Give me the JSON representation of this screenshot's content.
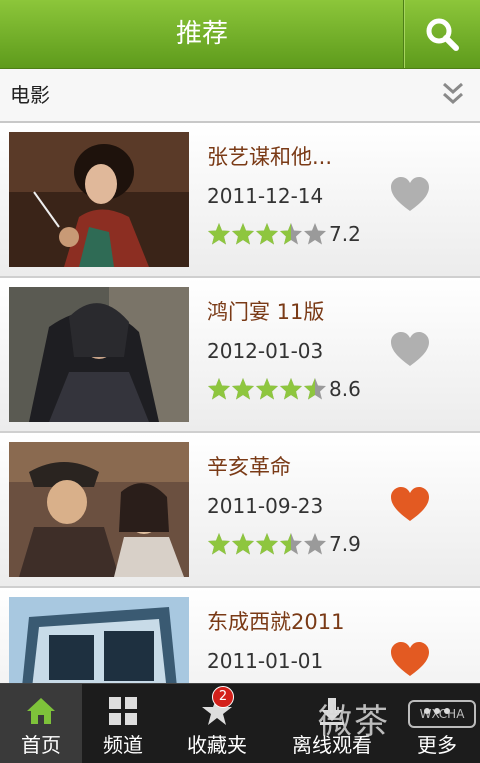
{
  "header": {
    "title": "推荐",
    "search_icon": "search-icon"
  },
  "category": {
    "label": "电影",
    "toggle_icon": "double-chevron-down-icon"
  },
  "movies": [
    {
      "title": "张艺谋和他...",
      "date": "2011-12-14",
      "stars": 3.5,
      "score": "7.2",
      "favorited": false
    },
    {
      "title": "鸿门宴 11版",
      "date": "2012-01-03",
      "stars": 4.5,
      "score": "8.6",
      "favorited": false
    },
    {
      "title": "辛亥革命",
      "date": "2011-09-23",
      "stars": 3.5,
      "score": "7.9",
      "favorited": true
    },
    {
      "title": "东成西就2011",
      "date": "2011-01-01",
      "stars": null,
      "score": "",
      "favorited": true
    }
  ],
  "tabs": [
    {
      "label": "首页",
      "icon": "home-icon",
      "active": true
    },
    {
      "label": "频道",
      "icon": "grid-icon",
      "active": false
    },
    {
      "label": "收藏夹",
      "icon": "star-icon",
      "active": false,
      "badge": "2"
    },
    {
      "label": "离线观看",
      "icon": "download-icon",
      "active": false
    },
    {
      "label": "更多",
      "icon": "more-icon",
      "active": false
    }
  ],
  "watermark": {
    "text": "微茶",
    "box": "WXCHA"
  },
  "colors": {
    "header_green": "#6aab26",
    "title_brown": "#7a3a16",
    "heart_grey": "#b0b0b0",
    "heart_orange": "#e35a22",
    "star_green": "#8ec63f",
    "tabbar": "#1c1c1c"
  }
}
